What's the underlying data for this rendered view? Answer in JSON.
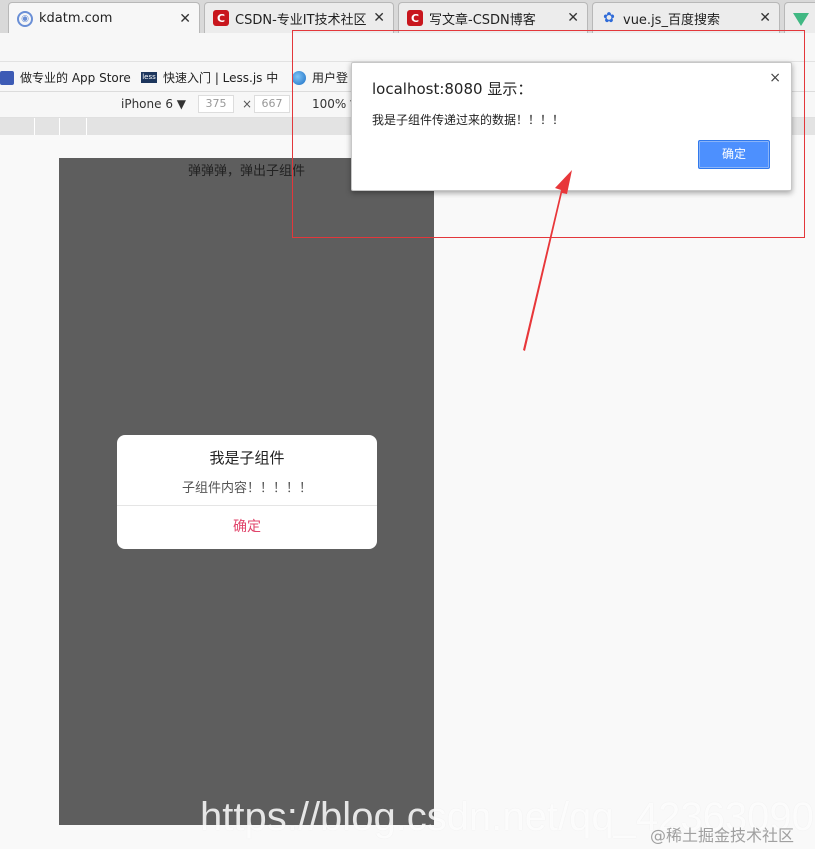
{
  "tabs": [
    {
      "label": "kdatm.com",
      "icon": "compass-icon",
      "active": true
    },
    {
      "label": "CSDN-专业IT技术社区",
      "icon": "csdn-icon",
      "active": false
    },
    {
      "label": "写文章-CSDN博客",
      "icon": "csdn-icon",
      "active": false
    },
    {
      "label": "vue.js_百度搜索",
      "icon": "baidu-paw-icon",
      "active": false
    }
  ],
  "bookmarks": [
    {
      "label": "做专业的 App Store",
      "icon": "app-store-icon"
    },
    {
      "label": "快速入门 | Less.js 中",
      "icon": "less-icon"
    },
    {
      "label": "用户登",
      "icon": "globe-icon"
    }
  ],
  "device_toolbar": {
    "device": "iPhone 6",
    "width": "375",
    "height": "667",
    "times": "×",
    "zoom": "100%"
  },
  "page": {
    "top_text": "弹弹弹，弹出子组件"
  },
  "child_dialog": {
    "title": "我是子组件",
    "content": "子组件内容！！！！！",
    "ok_label": "确定"
  },
  "alert": {
    "title": "localhost:8080 显示：",
    "message": "我是子组件传递过来的数据！！！！",
    "ok_label": "确定",
    "close": "×"
  },
  "watermark": {
    "url": "https://blog.csdn.net/qq_42363090",
    "site": "@稀土掘金技术社区"
  },
  "colors": {
    "accent_red": "#e3373b",
    "alert_button": "#4d90fe",
    "dialog_ok": "#e0456b",
    "overlay": "#5e5e5e"
  }
}
